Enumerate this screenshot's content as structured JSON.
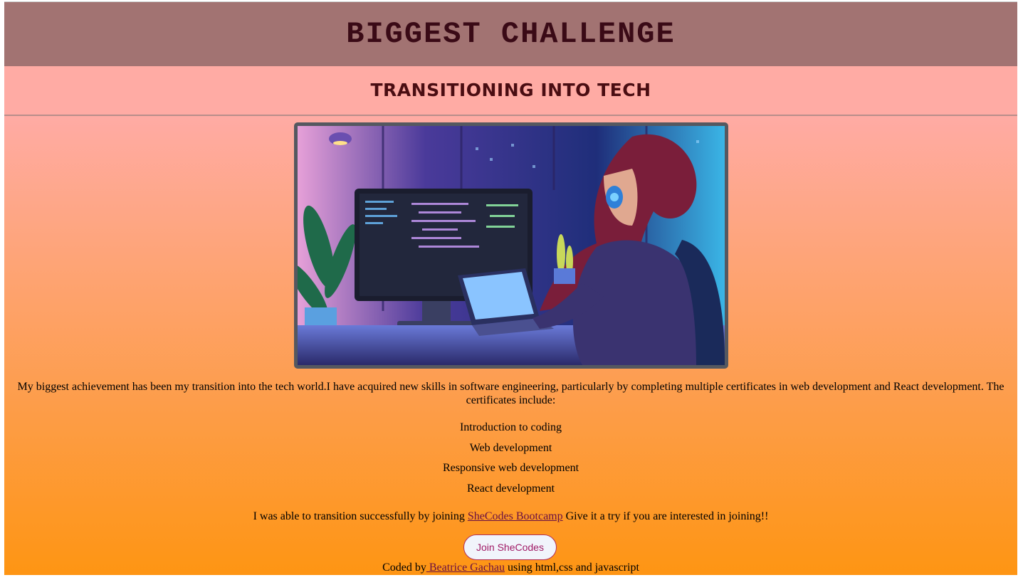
{
  "header": {
    "title": "BIGGEST CHALLENGE",
    "subtitle": "TRANSITIONING INTO TECH"
  },
  "hero_image": {
    "alt": "illustration-woman-coding-at-desk"
  },
  "content": {
    "intro": "My biggest achievement has been my transition into the tech world.I have acquired new skills in software engineering, particularly by completing multiple certificates in web development and React development. The certificates include:",
    "certificates": [
      "Introduction to coding",
      "Web development",
      "Responsive web development",
      "React development"
    ],
    "cta_before": "I was able to transition successfully by joining ",
    "cta_link": "SheCodes Bootcamp",
    "cta_after": " Give it a try if you are interested in joining!!"
  },
  "button": {
    "label": "Join SheCodes"
  },
  "footer": {
    "prefix": "Coded by",
    "author": " Beatrice Gachau",
    "suffix": " using html,css and javascript"
  },
  "colors": {
    "header_bg": "#a27372",
    "subheader_bg": "#ffaba4",
    "gradient_bottom": "#fe9513",
    "link": "#6a1043",
    "button_text": "#a01b66"
  }
}
